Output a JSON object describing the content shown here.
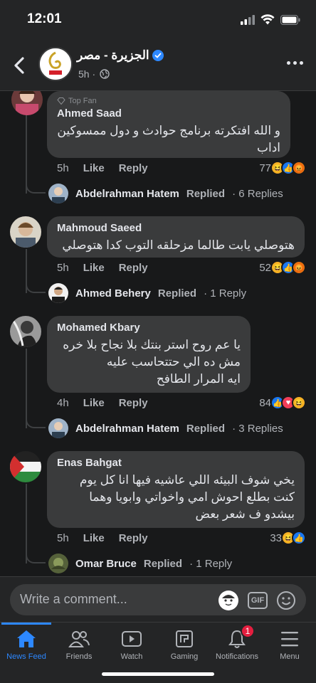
{
  "status": {
    "time": "12:01"
  },
  "header": {
    "page_name": "الجزيرة - مصر",
    "post_age": "5h ·"
  },
  "colors": {
    "accent": "#2d88ff",
    "like": "#1877f2",
    "haha": "#f7b125",
    "angry": "#e9710f",
    "love": "#f33e58",
    "badge": "#e41e3f"
  },
  "comments": [
    {
      "badge": "Top Fan",
      "author": "Ahmed Saad",
      "text_line1": "و الله افتكرته برنامج حوادث و دول ممسوكين",
      "text_line2": "اداب",
      "time": "5h",
      "like": "Like",
      "reply": "Reply",
      "count": "77",
      "reactions": [
        "haha",
        "like",
        "angry"
      ],
      "reply_author": "Abdelrahman Hatem",
      "replied": "Replied",
      "reply_count": "· 6 Replies"
    },
    {
      "author": "Mahmoud Saeed",
      "text_line1": "هتوصلي يابت طالما مزحلقه التوب كدا هتوصلي",
      "time": "5h",
      "like": "Like",
      "reply": "Reply",
      "count": "52",
      "reactions": [
        "haha",
        "like",
        "angry"
      ],
      "reply_author": "Ahmed Behery",
      "replied": "Replied",
      "reply_count": "· 1 Reply"
    },
    {
      "author": "Mohamed Kbary",
      "text_line1": "يا عم روح استر بنتك بلا نجاح بلا خره",
      "text_line2": "مش ده الي حتتحاسب عليه",
      "text_line3": "ايه المرار الطافح",
      "time": "4h",
      "like": "Like",
      "reply": "Reply",
      "count": "84",
      "reactions": [
        "like",
        "love",
        "haha"
      ],
      "reply_author": "Abdelrahman Hatem",
      "replied": "Replied",
      "reply_count": "· 3 Replies"
    },
    {
      "author": "Enas Bahgat",
      "text_line1": "يخي شوف البيئه اللي عاشيه فيها انا كل يوم",
      "text_line2": "كنت بطلع احوش امي واخواتي وابويا وهما",
      "text_line3": "بيشدو ف شعر بعض",
      "time": "5h",
      "like": "Like",
      "reply": "Reply",
      "count": "33",
      "reactions": [
        "haha",
        "like"
      ],
      "reply_author": "Omar Bruce",
      "replied": "Replied",
      "reply_count": "· 1 Reply"
    }
  ],
  "composer": {
    "placeholder": "Write a comment...",
    "gif": "GIF"
  },
  "tabs": [
    {
      "label": "News Feed",
      "icon": "home-icon"
    },
    {
      "label": "Friends",
      "icon": "friends-icon"
    },
    {
      "label": "Watch",
      "icon": "watch-icon"
    },
    {
      "label": "Gaming",
      "icon": "gaming-icon"
    },
    {
      "label": "Notifications",
      "icon": "bell-icon",
      "badge": "1"
    },
    {
      "label": "Menu",
      "icon": "menu-icon"
    }
  ]
}
